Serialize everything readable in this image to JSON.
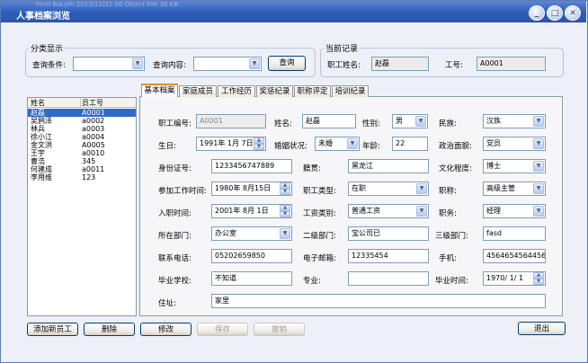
{
  "window": {
    "title": "人事档案浏览",
    "behind_text": "Fenil Bla.phi          2013/12/31 06          Object File          38 KB",
    "controls": {
      "minimize": "_",
      "maximize": "□",
      "close": "✕"
    }
  },
  "category": {
    "group_label": "分类显示",
    "condition_label": "查询条件:",
    "condition_value": "",
    "content_label": "查询内容:",
    "content_value": "",
    "query_button": "查询"
  },
  "current": {
    "group_label": "当前记录",
    "name_label": "职工姓名:",
    "name_value": "赵磊",
    "id_label": "工号:",
    "id_value": "A0001"
  },
  "list": {
    "headers": [
      "姓名",
      "员工号"
    ],
    "rows": [
      {
        "name": "赵磊",
        "id": "A0001",
        "selected": true
      },
      {
        "name": "吴鸦泽",
        "id": "a0002"
      },
      {
        "name": "林兵",
        "id": "a0003"
      },
      {
        "name": "徐小江",
        "id": "a0004"
      },
      {
        "name": "金文洪",
        "id": "A0005"
      },
      {
        "name": "王宇",
        "id": "a0010"
      },
      {
        "name": "曹浩",
        "id": "345"
      },
      {
        "name": "何建成",
        "id": "a0011"
      },
      {
        "name": "李用维",
        "id": "123"
      }
    ]
  },
  "tabs": [
    "基本档案",
    "家庭成员",
    "工作经历",
    "奖惩纪录",
    "职称评定",
    "培训纪录"
  ],
  "form": {
    "emp_no_label": "职工编号:",
    "emp_no": "A0001",
    "name_label": "姓名:",
    "name": "赵磊",
    "gender_label": "性别:",
    "gender": "男",
    "nation_label": "民族:",
    "nation": "汉族",
    "birth_label": "生日:",
    "birth": "1991年 1月 7日",
    "marital_label": "婚姻状况:",
    "marital": "未婚",
    "age_label": "年龄:",
    "age": "22",
    "politics_label": "政治面貌:",
    "politics": "党员",
    "idcard_label": "身份证号:",
    "idcard": "1233456747889",
    "native_label": "籍贯:",
    "native": "黑龙江",
    "education_label": "文化程度:",
    "education": "博士",
    "workstart_label": "参加工作时间:",
    "workstart": "1980年 8月15日",
    "emptype_label": "职工类型:",
    "emptype": "在职",
    "title_label": "职称:",
    "title": "高级主管",
    "entry_label": "入职时间:",
    "entry": "2001年 8月 1日",
    "salary_label": "工资类别:",
    "salary": "普通工资",
    "duty_label": "职务:",
    "duty": "经理",
    "dept_label": "所在部门:",
    "dept": "办公室",
    "dept2_label": "二级部门:",
    "dept2": "宝公司已",
    "dept3_label": "三级部门:",
    "dept3": "fasd",
    "phone_label": "联系电话:",
    "phone": "05202659850",
    "email_label": "电子邮箱:",
    "email": "12335454",
    "mobile_label": "手机:",
    "mobile": "4564654564456",
    "school_label": "毕业学校:",
    "school": "不知道",
    "major_label": "专业:",
    "major": "",
    "graddate_label": "毕业时间:",
    "graddate": "1970/ 1/ 1",
    "address_label": "住址:",
    "address": "家里"
  },
  "buttons": {
    "add": "添加新员工",
    "delete": "删除",
    "modify": "修改",
    "save": "保存",
    "undo": "撤销",
    "exit": "退出"
  }
}
